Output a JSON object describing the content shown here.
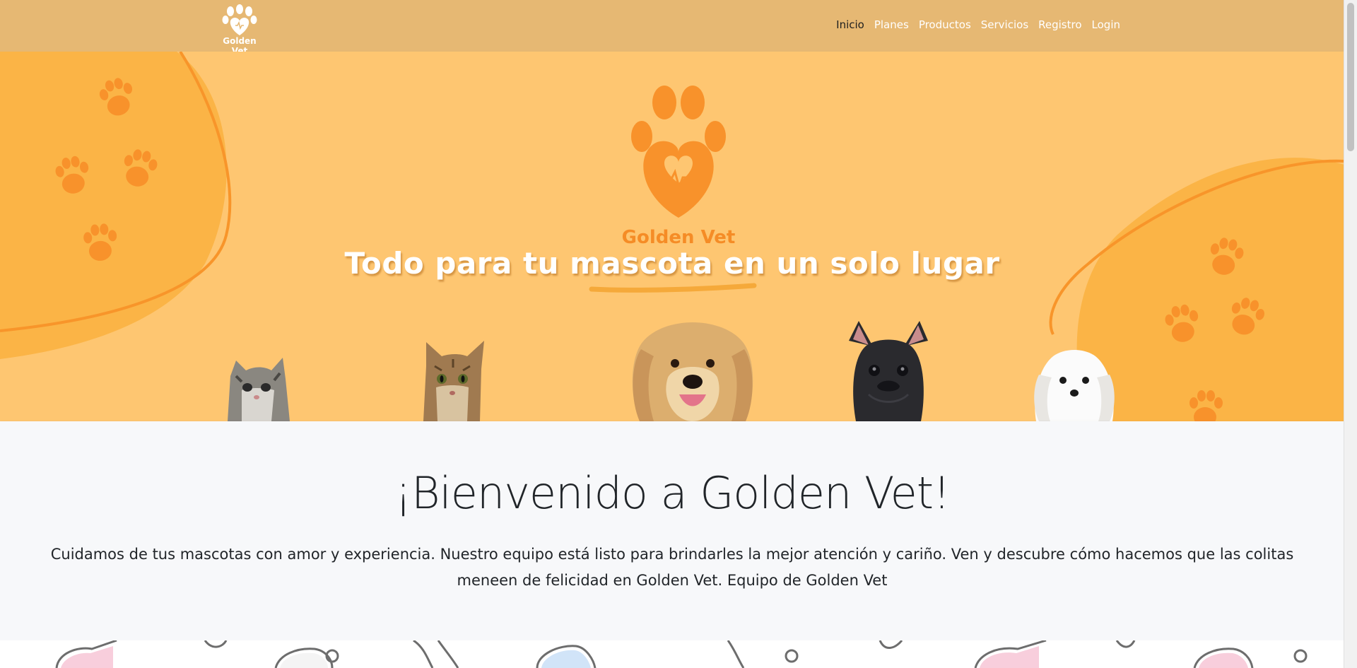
{
  "navbar": {
    "logo_text": "Golden Vet",
    "links": [
      {
        "label": "Inicio",
        "active": true
      },
      {
        "label": "Planes"
      },
      {
        "label": "Productos"
      },
      {
        "label": "Servicios"
      },
      {
        "label": "Registro"
      },
      {
        "label": "Login"
      }
    ],
    "background": "#e6b873"
  },
  "hero": {
    "logo_text": "Golden Vet",
    "tagline": "Todo para tu mascota en un solo lugar",
    "background": "#fec671",
    "accent": "#f58c26",
    "animals": [
      "kitten-image",
      "tabby-cat-image",
      "golden-retriever-image",
      "french-bulldog-image",
      "maltese-dog-image"
    ]
  },
  "welcome": {
    "title": "¡Bienvenido a Golden Vet!",
    "text": "Cuidamos de tus mascotas con amor y experiencia. Nuestro equipo está listo para brindarles la mejor atención y cariño. Ven y descubre cómo hacemos que las colitas meneen de felicidad en Golden Vet. Equipo de Golden Vet"
  }
}
